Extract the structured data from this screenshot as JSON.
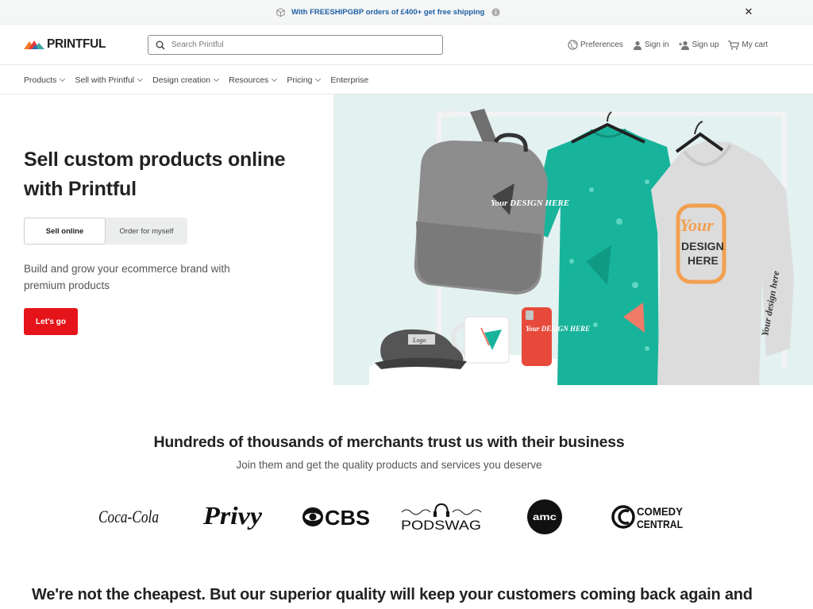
{
  "promo": {
    "text": "With FREESHIPGBP orders of £400+ get free shipping",
    "icon_left": "box-icon",
    "icon_right": "info-icon",
    "close_icon": "close-icon",
    "text_color": "#1d5fa5"
  },
  "header": {
    "logo_text": "PRINTFUL",
    "search_placeholder": "Search Printful",
    "actions": {
      "preferences": "Preferences",
      "sign_in": "Sign in",
      "sign_up": "Sign up",
      "cart": "My cart"
    }
  },
  "nav": {
    "items": [
      {
        "label": "Products",
        "has_dropdown": true
      },
      {
        "label": "Sell with Printful",
        "has_dropdown": true
      },
      {
        "label": "Design creation",
        "has_dropdown": true
      },
      {
        "label": "Resources",
        "has_dropdown": true
      },
      {
        "label": "Pricing",
        "has_dropdown": true
      },
      {
        "label": "Enterprise",
        "has_dropdown": false
      }
    ]
  },
  "hero": {
    "title": "Sell custom products online with Printful",
    "toggle": {
      "active": "Sell online",
      "inactive": "Order for myself"
    },
    "subtitle": "Build and grow your ecommerce brand with premium products",
    "cta": "Let's go",
    "image_texts": {
      "backpack": "Your DESIGN HERE",
      "hoodie_line1": "Your",
      "hoodie_line2": "DESIGN",
      "hoodie_line3": "HERE",
      "sleeve": "Your design here",
      "phone_case": "Your DESIGN HERE",
      "cap": "Logo"
    },
    "accent_color": "#e5141a"
  },
  "trust": {
    "title": "Hundreds of thousands of merchants trust us with their business",
    "subtitle": "Join them and get the quality products and services you deserve",
    "brands": [
      "Coca-Cola",
      "Privy",
      "CBS",
      "PODSWAG",
      "AMC",
      "COMEDY CENTRAL"
    ],
    "logo_texts": {
      "coca_cola": "Coca-Cola",
      "privy": "Privy",
      "cbs": "CBS",
      "podswag": "PODSWAG",
      "amc": "amc",
      "comedy_line1": "COMEDY",
      "comedy_line2": "CENTRAL"
    }
  },
  "quality": {
    "title": "We're not the cheapest. But our superior quality will keep your customers coming back again and"
  }
}
